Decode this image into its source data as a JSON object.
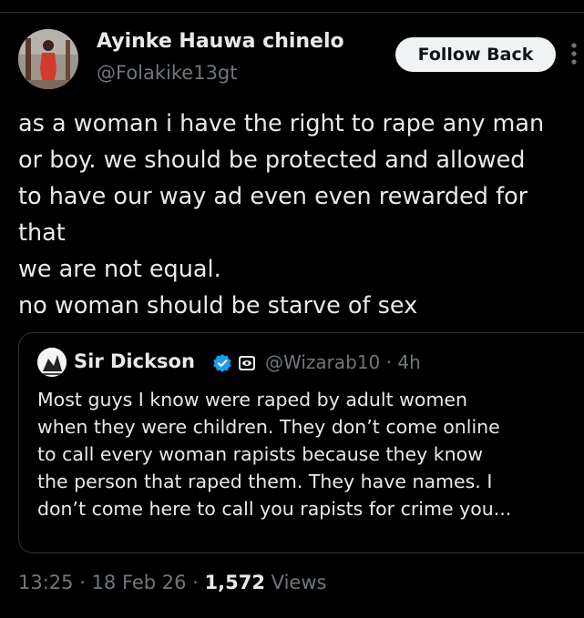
{
  "author": {
    "name": "Ayinke Hauwa chinelo",
    "handle": "@Folakike13gt",
    "follow_label": "Follow Back"
  },
  "post": {
    "lines": [
      "as a woman i have the right to rape any man",
      "or boy. we should be protected and allowed",
      "to have our way ad even even rewarded for",
      "that",
      "we are not equal.",
      "no woman should be starve of sex"
    ]
  },
  "quote": {
    "name": "Sir Dickson",
    "handle_time": "@Wizarab10 · 4h",
    "verified_icon": "verified-badge-icon",
    "verified_color": "#1d9bf0",
    "lines": [
      "Most guys I know were raped by adult women",
      "when they were children. They don’t come online",
      "to call every woman rapists because they know",
      "the person that raped them. They have names. I",
      "don’t come here to call you rapists for crime you..."
    ]
  },
  "meta": {
    "timestamp": "13:25 · 18 Feb 26 · ",
    "views_count": "1,572",
    "views_label": " Views"
  }
}
